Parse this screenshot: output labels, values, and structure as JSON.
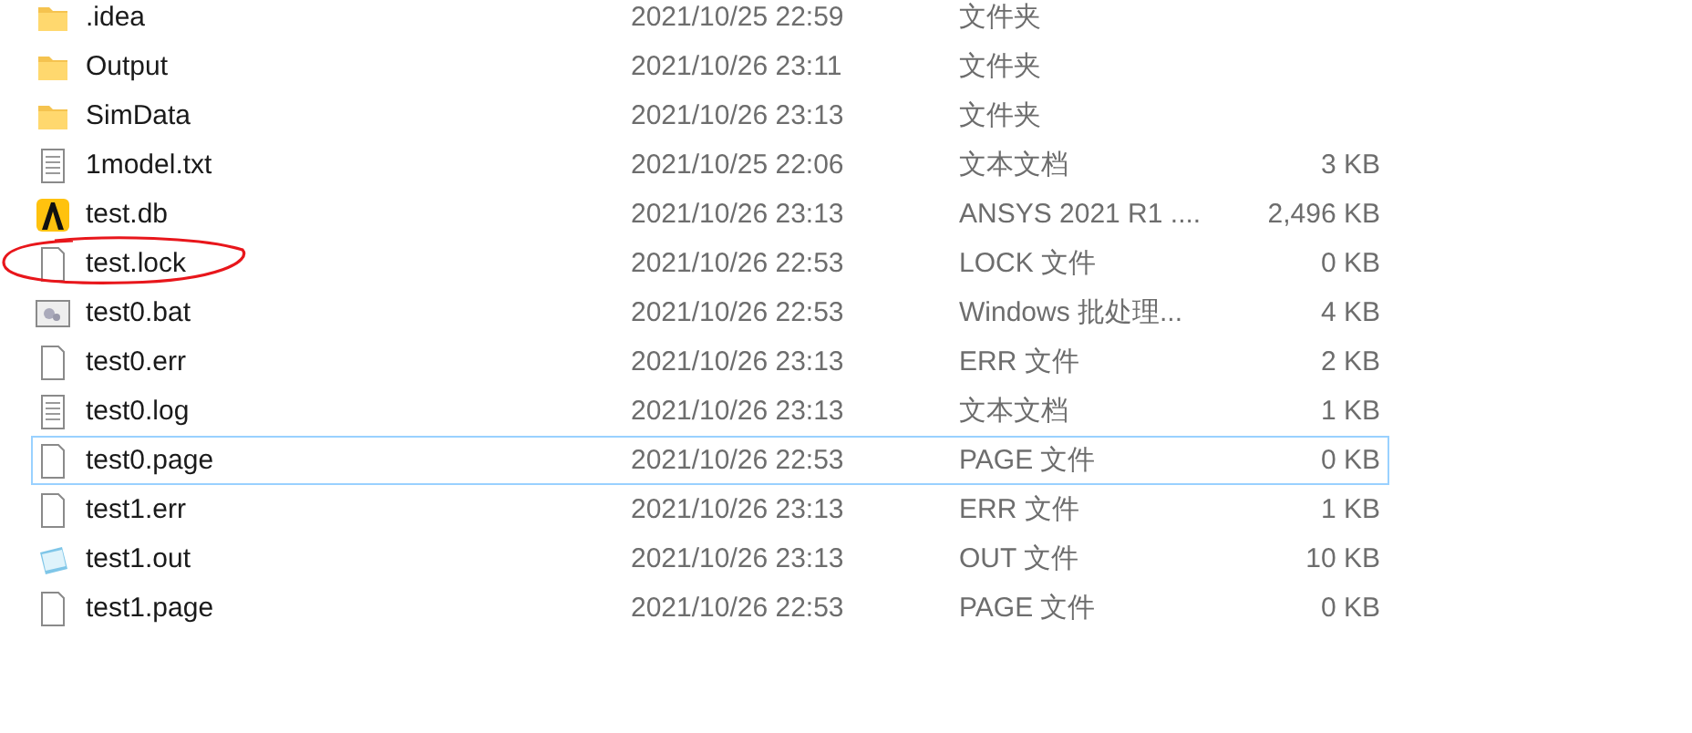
{
  "files": [
    {
      "kind": "folder",
      "name": ".idea",
      "date": "2021/10/25 22:59",
      "type": "文件夹",
      "circled": false,
      "focused": false
    },
    {
      "kind": "folder",
      "name": "Output",
      "date": "2021/10/26 23:11",
      "type": "文件夹",
      "circled": false,
      "focused": false
    },
    {
      "kind": "folder",
      "name": "SimData",
      "date": "2021/10/26 23:13",
      "type": "文件夹",
      "circled": false,
      "focused": false
    },
    {
      "kind": "text",
      "name": "1model.txt",
      "date": "2021/10/25 22:06",
      "type": "文本文档",
      "size": "3 KB",
      "circled": false,
      "focused": false
    },
    {
      "kind": "app",
      "name": "test.db",
      "date": "2021/10/26 23:13",
      "type": "ANSYS 2021 R1 ....",
      "size": "2,496 KB",
      "circled": false,
      "focused": false
    },
    {
      "kind": "blank",
      "name": "test.lock",
      "date": "2021/10/26 22:53",
      "type": "LOCK 文件",
      "size": "0 KB",
      "circled": true,
      "focused": false
    },
    {
      "kind": "batch",
      "name": "test0.bat",
      "date": "2021/10/26 22:53",
      "type": "Windows 批处理...",
      "size": "4 KB",
      "circled": false,
      "focused": false
    },
    {
      "kind": "blank",
      "name": "test0.err",
      "date": "2021/10/26 23:13",
      "type": "ERR 文件",
      "size": "2 KB",
      "circled": false,
      "focused": false
    },
    {
      "kind": "text",
      "name": "test0.log",
      "date": "2021/10/26 23:13",
      "type": "文本文档",
      "size": "1 KB",
      "circled": false,
      "focused": false
    },
    {
      "kind": "blank",
      "name": "test0.page",
      "date": "2021/10/26 22:53",
      "type": "PAGE 文件",
      "size": "0 KB",
      "circled": false,
      "focused": true
    },
    {
      "kind": "blank",
      "name": "test1.err",
      "date": "2021/10/26 23:13",
      "type": "ERR 文件",
      "size": "1 KB",
      "circled": false,
      "focused": false
    },
    {
      "kind": "notepad",
      "name": "test1.out",
      "date": "2021/10/26 23:13",
      "type": "OUT 文件",
      "size": "10 KB",
      "circled": false,
      "focused": false
    },
    {
      "kind": "blank",
      "name": "test1.page",
      "date": "2021/10/26 22:53",
      "type": "PAGE 文件",
      "size": "0 KB",
      "circled": false,
      "focused": false
    }
  ]
}
